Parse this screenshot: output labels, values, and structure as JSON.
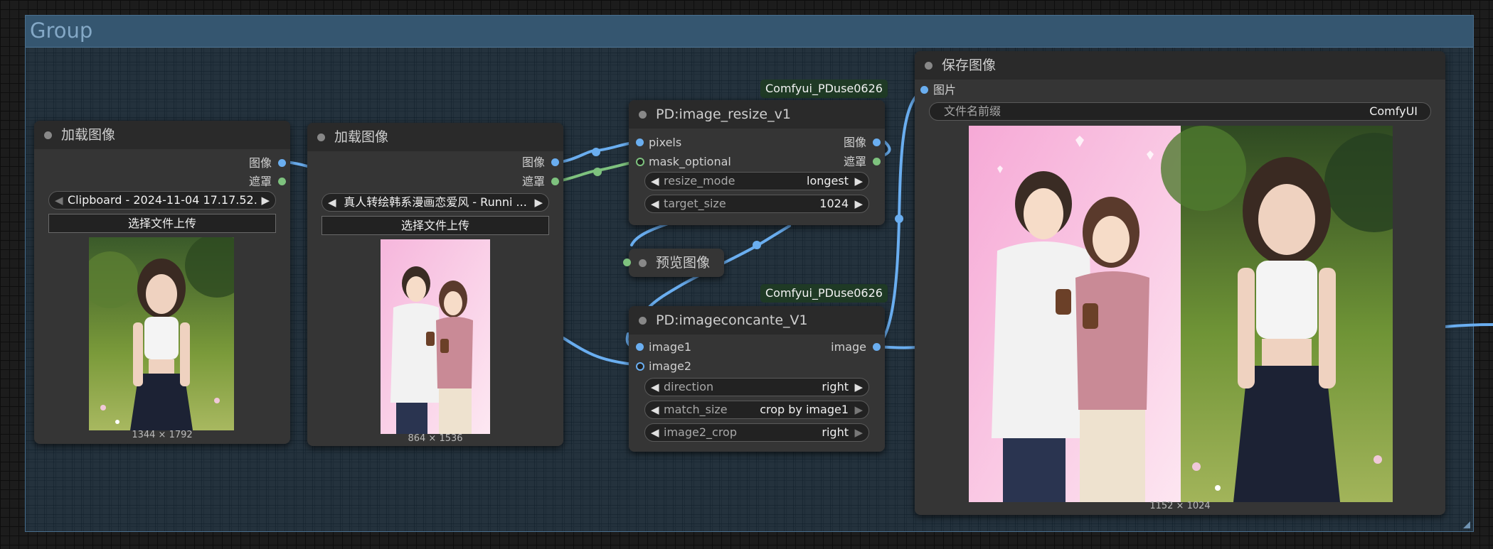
{
  "group": {
    "title": "Group"
  },
  "nodes": {
    "load1": {
      "title": "加载图像",
      "outputs": [
        "图像",
        "遮罩"
      ],
      "file": "Clipboard - 2024-11-04 17.17.52....",
      "upload": "选择文件上传",
      "dims": "1344 × 1792"
    },
    "load2": {
      "title": "加载图像",
      "outputs": [
        "图像",
        "遮罩"
      ],
      "file": "真人转绘韩系漫画恋爱风 - Runni ...",
      "upload": "选择文件上传",
      "dims": "864 × 1536"
    },
    "resize": {
      "badge": "Comfyui_PDuse0626",
      "title": "PD:image_resize_v1",
      "inputs": [
        "pixels",
        "mask_optional"
      ],
      "outputs": [
        "图像",
        "遮罩"
      ],
      "widgets": [
        {
          "label": "resize_mode",
          "value": "longest"
        },
        {
          "label": "target_size",
          "value": "1024"
        }
      ]
    },
    "preview": {
      "title": "预览图像"
    },
    "concat": {
      "badge": "Comfyui_PDuse0626",
      "title": "PD:imageconcante_V1",
      "inputs": [
        "image1",
        "image2"
      ],
      "output": "image",
      "widgets": [
        {
          "label": "direction",
          "value": "right"
        },
        {
          "label": "match_size",
          "value": "crop by image1"
        },
        {
          "label": "image2_crop",
          "value": "right"
        }
      ]
    },
    "save": {
      "title": "保存图像",
      "input": "图片",
      "prefix_label": "文件名前缀",
      "prefix_value": "ComfyUI",
      "dims": "1152 × 1024"
    }
  },
  "colors": {
    "image_wire": "#6aaef0",
    "mask_wire": "#7ec27e",
    "badge_bg": "#1f3a25"
  }
}
